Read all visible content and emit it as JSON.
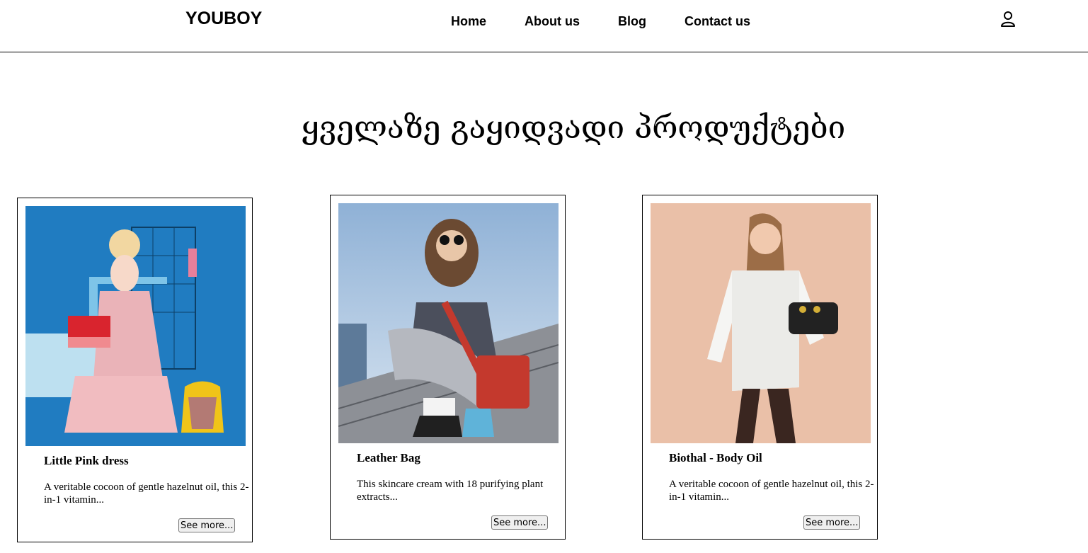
{
  "header": {
    "logo": "YOUBOY",
    "nav": [
      "Home",
      "About us",
      "Blog",
      "Contact us"
    ],
    "user_icon": "user-icon"
  },
  "main": {
    "title": "ყველაზე გაყიდვადი პროდუქტები",
    "products": [
      {
        "name": "Little Pink dress",
        "description": "A veritable cocoon of gentle hazelnut oil, this 2-in-1 vitamin...",
        "button": "See more...",
        "image_bg": "#1b74b8"
      },
      {
        "name": "Leather Bag",
        "description": "This skincare cream with 18 purifying plant extracts...",
        "button": "See more...",
        "image_bg": "#aac3e0"
      },
      {
        "name": "Biothal - Body Oil",
        "description": "A veritable cocoon of gentle hazelnut oil, this 2-in-1 vitamin...",
        "button": "See more...",
        "image_bg": "#e6b9a0"
      }
    ]
  }
}
